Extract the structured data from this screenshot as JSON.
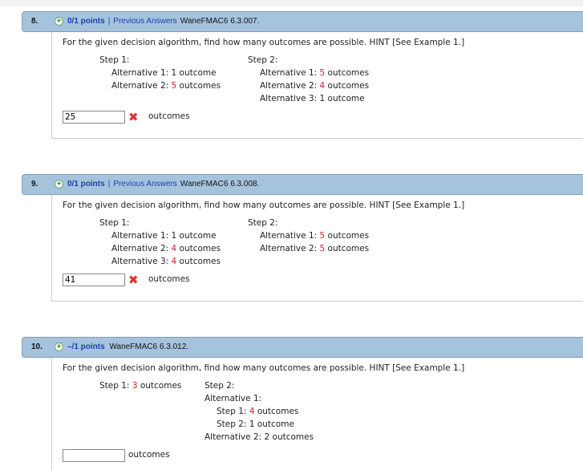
{
  "questions": [
    {
      "number": "8.",
      "points": "0/1 points",
      "separator": "|",
      "previous": "Previous Answers",
      "source": "WaneFMAC6 6.3.007.",
      "prompt": "For the given decision algorithm, find how many outcomes are possible. HINT [See Example 1.]",
      "step1": "Step 1:",
      "step2": "Step 2:",
      "s1": [
        {
          "label": "Alternative 1: ",
          "n": "1",
          "unit": " outcome",
          "red": false
        },
        {
          "label": "Alternative 2: ",
          "n": "5",
          "unit": " outcomes",
          "red": true
        }
      ],
      "s2": [
        {
          "label": "Alternative 1: ",
          "n": "5",
          "unit": " outcomes",
          "red": true
        },
        {
          "label": "Alternative 2: ",
          "n": "4",
          "unit": " outcomes",
          "red": true
        },
        {
          "label": "Alternative 3: ",
          "n": "1",
          "unit": " outcome",
          "red": false
        }
      ],
      "answer": "25",
      "unit": "outcomes",
      "status": "incorrect"
    },
    {
      "number": "9.",
      "points": "0/1 points",
      "separator": "|",
      "previous": "Previous Answers",
      "source": "WaneFMAC6 6.3.008.",
      "prompt": "For the given decision algorithm, find how many outcomes are possible. HINT [See Example 1.]",
      "step1": "Step 1:",
      "step2": "Step 2:",
      "s1": [
        {
          "label": "Alternative 1: ",
          "n": "1",
          "unit": " outcome",
          "red": false
        },
        {
          "label": "Alternative 2: ",
          "n": "4",
          "unit": " outcomes",
          "red": true
        },
        {
          "label": "Alternative 3: ",
          "n": "4",
          "unit": " outcomes",
          "red": true
        }
      ],
      "s2": [
        {
          "label": "Alternative 1: ",
          "n": "5",
          "unit": " outcomes",
          "red": true
        },
        {
          "label": "Alternative 2: ",
          "n": "5",
          "unit": " outcomes",
          "red": true
        }
      ],
      "answer": "41",
      "unit": "outcomes",
      "status": "incorrect"
    },
    {
      "number": "10.",
      "points": "–/1 points",
      "source": "WaneFMAC6 6.3.012.",
      "prompt": "For the given decision algorithm, find how many outcomes are possible. HINT [See Example 1.]",
      "step1_label": "Step 1: ",
      "step1_n": "3",
      "step1_unit": " outcomes",
      "step2": "Step 2:",
      "alt1": "Alternative 1:",
      "sub": [
        {
          "label": "Step 1: ",
          "n": "4",
          "unit": " outcomes",
          "red": true
        },
        {
          "label": "Step 2: ",
          "n": "1",
          "unit": " outcome",
          "red": false
        }
      ],
      "alt2": "Alternative 2: 2 outcomes",
      "answer": "",
      "unit": "outcomes"
    }
  ]
}
